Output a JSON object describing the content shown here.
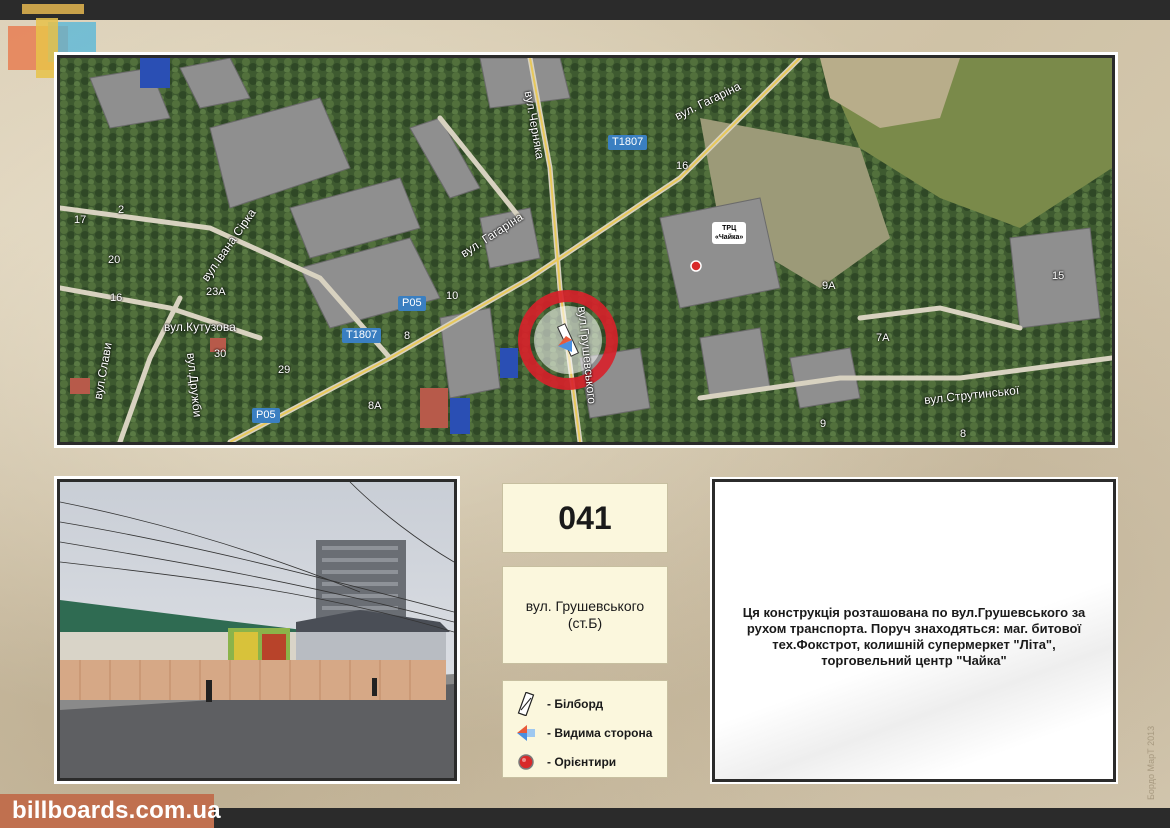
{
  "brand": {
    "site": "billboards.com.ua",
    "copyright": "Бордо МарТ 2013"
  },
  "map": {
    "streets": [
      "вул. Гагаріна",
      "вул.Черняка",
      "вул. Гагаріна",
      "вул.Івана Сірка",
      "вул.Кутузова",
      "вул.Слави",
      "вул.Дружби",
      "вул.Грушевського",
      "вул.Струтинської"
    ],
    "routes": [
      "T1807",
      "T1807",
      "P05",
      "P05"
    ],
    "house_numbers": [
      "17",
      "2",
      "20",
      "16",
      "23А",
      "30",
      "29",
      "10",
      "8",
      "8А",
      "16",
      "9А",
      "7А",
      "15",
      "9",
      "8"
    ],
    "poi": {
      "line1": "ТРЦ",
      "line2": "«Чайка»"
    }
  },
  "board": {
    "number": "041",
    "address_line1": "вул. Грушевського",
    "address_line2": "(ст.Б)"
  },
  "legend": [
    {
      "icon": "billboard-icon",
      "label": "- Білборд"
    },
    {
      "icon": "visible-side-icon",
      "label": "- Видима сторона"
    },
    {
      "icon": "landmark-icon",
      "label": "- Орієнтири"
    }
  ],
  "description": "Ця конструкція розташована по вул.Грушевського за рухом транспорта. Поруч знаходяться: маг. битової тех.Фокстрот, колишній супермеркет \"Літа\", торговельний центр \"Чайка\"",
  "colors": {
    "brand": "#c0704f",
    "bar": "#2b2b2b",
    "panel": "#fbf7dd",
    "route": "#3a7fc1"
  }
}
